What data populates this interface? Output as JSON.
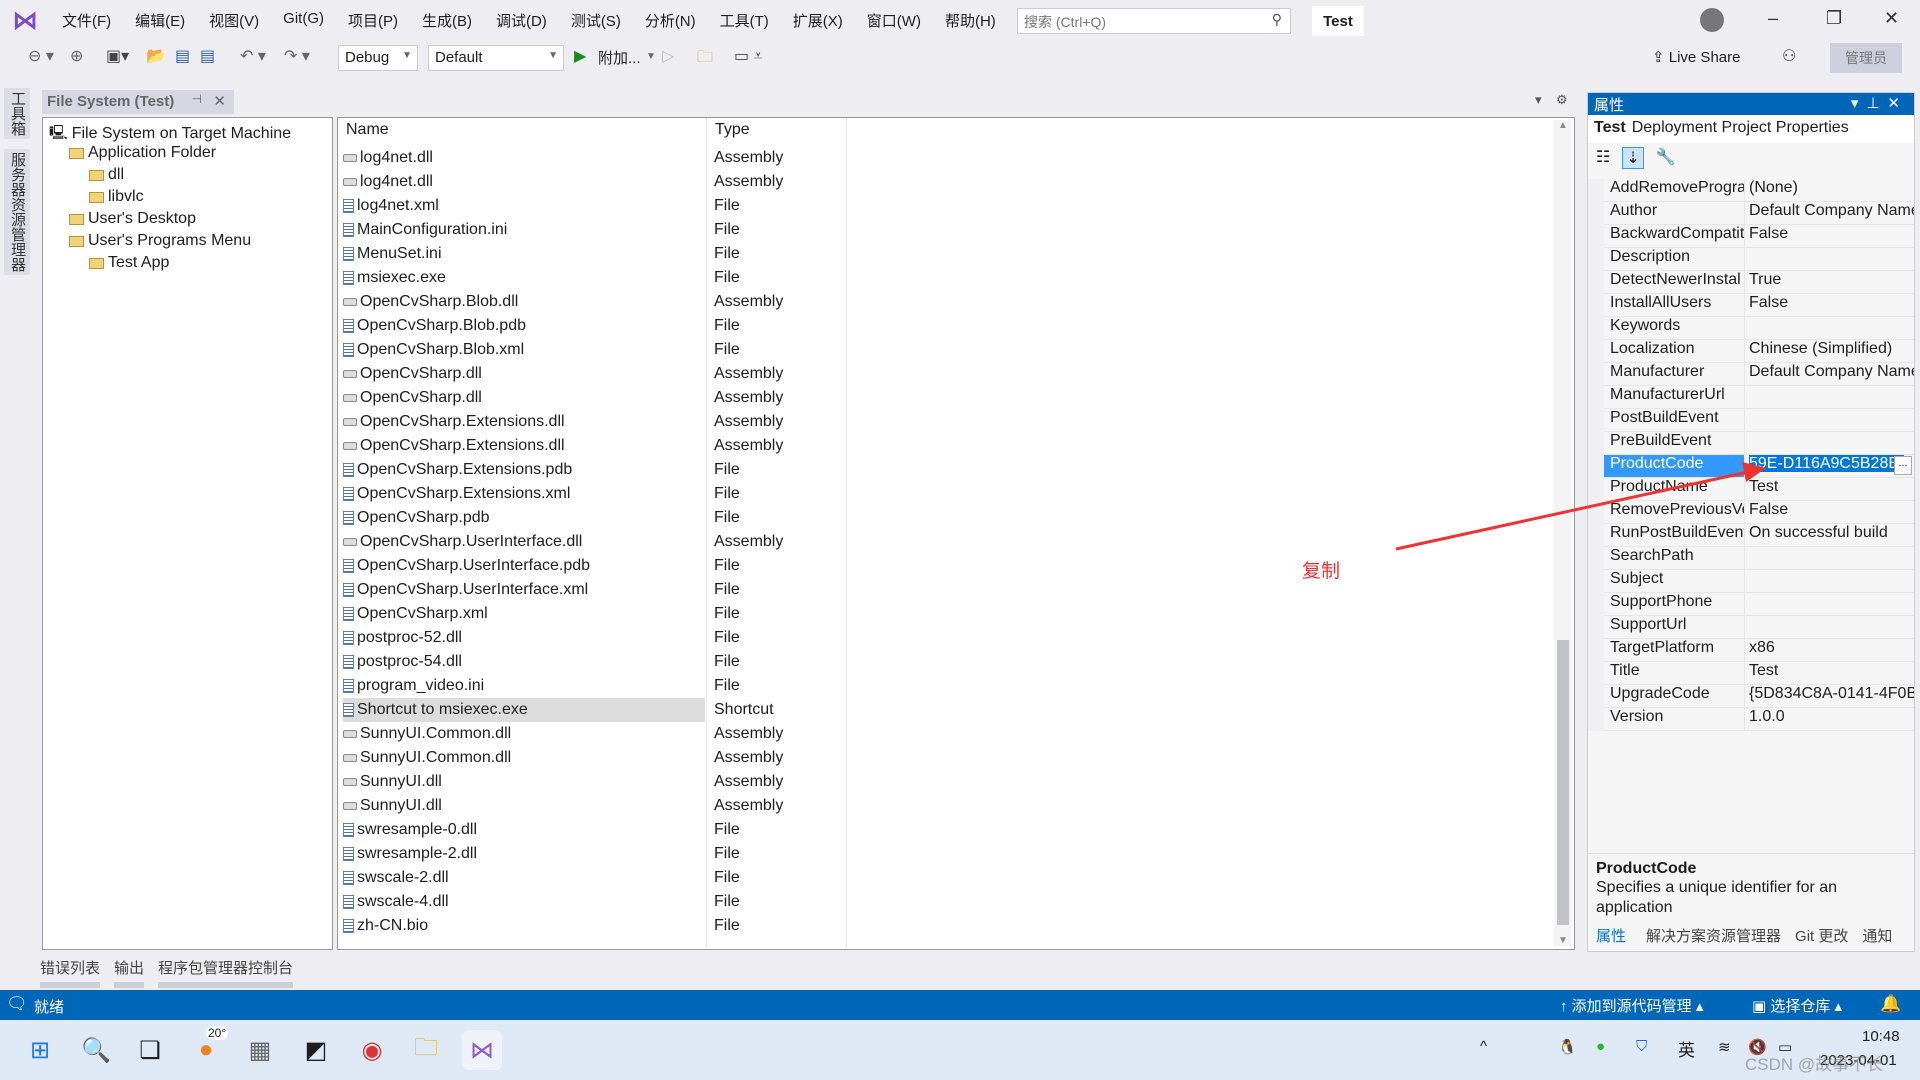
{
  "menu": [
    "文件(F)",
    "编辑(E)",
    "视图(V)",
    "Git(G)",
    "项目(P)",
    "生成(B)",
    "调试(D)",
    "测试(S)",
    "分析(N)",
    "工具(T)",
    "扩展(X)",
    "窗口(W)",
    "帮助(H)"
  ],
  "search": {
    "placeholder": "搜索 (Ctrl+Q)"
  },
  "solution_name": "Test",
  "toolbar": {
    "config": "Debug",
    "platform": "Default",
    "run": "附加...",
    "live_share": "Live Share",
    "admin": "管理员"
  },
  "side_strip": [
    "工具箱",
    "服务器资源管理器"
  ],
  "doc_tab": {
    "title": "File System (Test)"
  },
  "tree": [
    {
      "label": "File System on Target Machine",
      "level": 0,
      "icon": "computer-icon"
    },
    {
      "label": "Application Folder",
      "level": 1,
      "icon": "special-folder-icon"
    },
    {
      "label": "dll",
      "level": 2,
      "icon": "folder-icon"
    },
    {
      "label": "libvlc",
      "level": 2,
      "icon": "folder-icon"
    },
    {
      "label": "User's Desktop",
      "level": 1,
      "icon": "special-folder-icon"
    },
    {
      "label": "User's Programs Menu",
      "level": 1,
      "icon": "special-folder-icon"
    },
    {
      "label": "Test App",
      "level": 2,
      "icon": "folder-icon"
    }
  ],
  "list": {
    "headers": {
      "name": "Name",
      "type": "Type"
    },
    "selected_index": 23,
    "rows": [
      [
        "log4net.dll",
        "Assembly"
      ],
      [
        "log4net.dll",
        "Assembly"
      ],
      [
        "log4net.xml",
        "File"
      ],
      [
        "MainConfiguration.ini",
        "File"
      ],
      [
        "MenuSet.ini",
        "File"
      ],
      [
        "msiexec.exe",
        "File"
      ],
      [
        "OpenCvSharp.Blob.dll",
        "Assembly"
      ],
      [
        "OpenCvSharp.Blob.pdb",
        "File"
      ],
      [
        "OpenCvSharp.Blob.xml",
        "File"
      ],
      [
        "OpenCvSharp.dll",
        "Assembly"
      ],
      [
        "OpenCvSharp.dll",
        "Assembly"
      ],
      [
        "OpenCvSharp.Extensions.dll",
        "Assembly"
      ],
      [
        "OpenCvSharp.Extensions.dll",
        "Assembly"
      ],
      [
        "OpenCvSharp.Extensions.pdb",
        "File"
      ],
      [
        "OpenCvSharp.Extensions.xml",
        "File"
      ],
      [
        "OpenCvSharp.pdb",
        "File"
      ],
      [
        "OpenCvSharp.UserInterface.dll",
        "Assembly"
      ],
      [
        "OpenCvSharp.UserInterface.pdb",
        "File"
      ],
      [
        "OpenCvSharp.UserInterface.xml",
        "File"
      ],
      [
        "OpenCvSharp.xml",
        "File"
      ],
      [
        "postproc-52.dll",
        "File"
      ],
      [
        "postproc-54.dll",
        "File"
      ],
      [
        "program_video.ini",
        "File"
      ],
      [
        "Shortcut to msiexec.exe",
        "Shortcut"
      ],
      [
        "SunnyUI.Common.dll",
        "Assembly"
      ],
      [
        "SunnyUI.Common.dll",
        "Assembly"
      ],
      [
        "SunnyUI.dll",
        "Assembly"
      ],
      [
        "SunnyUI.dll",
        "Assembly"
      ],
      [
        "swresample-0.dll",
        "File"
      ],
      [
        "swresample-2.dll",
        "File"
      ],
      [
        "swscale-2.dll",
        "File"
      ],
      [
        "swscale-4.dll",
        "File"
      ],
      [
        "zh-CN.bio",
        "File"
      ]
    ]
  },
  "properties": {
    "title": "属性",
    "object_name": "Test",
    "object_type": "Deployment Project Properties",
    "selected_index": 12,
    "rows": [
      [
        "AddRemoveProgra",
        "(None)"
      ],
      [
        "Author",
        "Default Company Name"
      ],
      [
        "BackwardCompatit",
        "False"
      ],
      [
        "Description",
        ""
      ],
      [
        "DetectNewerInstal",
        "True"
      ],
      [
        "InstallAllUsers",
        "False"
      ],
      [
        "Keywords",
        ""
      ],
      [
        "Localization",
        "Chinese (Simplified)"
      ],
      [
        "Manufacturer",
        "Default Company Name"
      ],
      [
        "ManufacturerUrl",
        ""
      ],
      [
        "PostBuildEvent",
        ""
      ],
      [
        "PreBuildEvent",
        ""
      ],
      [
        "ProductCode",
        "59E-D116A9C5B28E}"
      ],
      [
        "ProductName",
        "Test"
      ],
      [
        "RemovePreviousVe",
        "False"
      ],
      [
        "RunPostBuildEvent",
        "On successful build"
      ],
      [
        "SearchPath",
        ""
      ],
      [
        "Subject",
        ""
      ],
      [
        "SupportPhone",
        ""
      ],
      [
        "SupportUrl",
        ""
      ],
      [
        "TargetPlatform",
        "x86"
      ],
      [
        "Title",
        "Test"
      ],
      [
        "UpgradeCode",
        "{5D834C8A-0141-4F0B"
      ],
      [
        "Version",
        "1.0.0"
      ]
    ],
    "desc_title": "ProductCode",
    "desc_text": "Specifies a unique identifier for an application",
    "tabs": [
      "属性",
      "解决方案资源管理器",
      "Git 更改",
      "通知"
    ]
  },
  "bottom_tabs": [
    "错误列表",
    "输出",
    "程序包管理器控制台"
  ],
  "status": {
    "text": "就绪",
    "source_control": "添加到源代码管理",
    "repo": "选择仓库"
  },
  "taskbar": {
    "weather": "20°",
    "ime": "英",
    "time": "10:48",
    "date": "2023-04-01"
  },
  "annotation": {
    "text": "复制",
    "color": "#ee3333"
  },
  "watermark": "CSDN @故事不长",
  "colors": {
    "accent": "#0067b8",
    "selection": "#3399ff"
  }
}
